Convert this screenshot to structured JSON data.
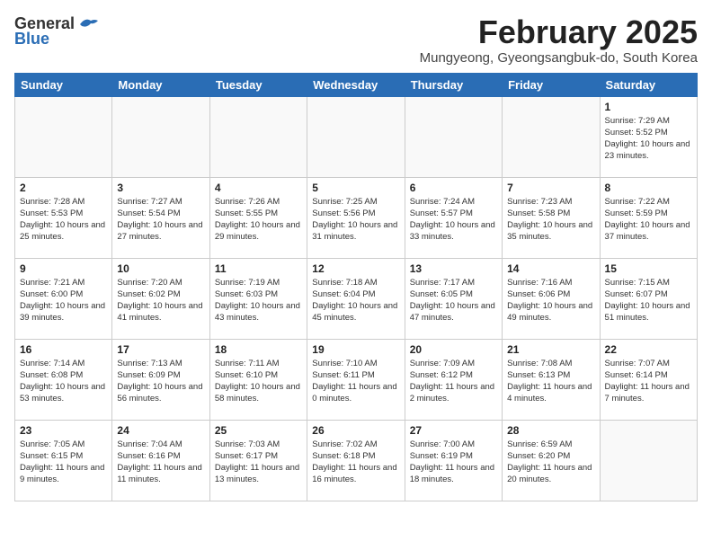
{
  "header": {
    "logo_general": "General",
    "logo_blue": "Blue",
    "month_title": "February 2025",
    "subtitle": "Mungyeong, Gyeongsangbuk-do, South Korea"
  },
  "weekdays": [
    "Sunday",
    "Monday",
    "Tuesday",
    "Wednesday",
    "Thursday",
    "Friday",
    "Saturday"
  ],
  "weeks": [
    [
      {
        "day": "",
        "info": ""
      },
      {
        "day": "",
        "info": ""
      },
      {
        "day": "",
        "info": ""
      },
      {
        "day": "",
        "info": ""
      },
      {
        "day": "",
        "info": ""
      },
      {
        "day": "",
        "info": ""
      },
      {
        "day": "1",
        "info": "Sunrise: 7:29 AM\nSunset: 5:52 PM\nDaylight: 10 hours and 23 minutes."
      }
    ],
    [
      {
        "day": "2",
        "info": "Sunrise: 7:28 AM\nSunset: 5:53 PM\nDaylight: 10 hours and 25 minutes."
      },
      {
        "day": "3",
        "info": "Sunrise: 7:27 AM\nSunset: 5:54 PM\nDaylight: 10 hours and 27 minutes."
      },
      {
        "day": "4",
        "info": "Sunrise: 7:26 AM\nSunset: 5:55 PM\nDaylight: 10 hours and 29 minutes."
      },
      {
        "day": "5",
        "info": "Sunrise: 7:25 AM\nSunset: 5:56 PM\nDaylight: 10 hours and 31 minutes."
      },
      {
        "day": "6",
        "info": "Sunrise: 7:24 AM\nSunset: 5:57 PM\nDaylight: 10 hours and 33 minutes."
      },
      {
        "day": "7",
        "info": "Sunrise: 7:23 AM\nSunset: 5:58 PM\nDaylight: 10 hours and 35 minutes."
      },
      {
        "day": "8",
        "info": "Sunrise: 7:22 AM\nSunset: 5:59 PM\nDaylight: 10 hours and 37 minutes."
      }
    ],
    [
      {
        "day": "9",
        "info": "Sunrise: 7:21 AM\nSunset: 6:00 PM\nDaylight: 10 hours and 39 minutes."
      },
      {
        "day": "10",
        "info": "Sunrise: 7:20 AM\nSunset: 6:02 PM\nDaylight: 10 hours and 41 minutes."
      },
      {
        "day": "11",
        "info": "Sunrise: 7:19 AM\nSunset: 6:03 PM\nDaylight: 10 hours and 43 minutes."
      },
      {
        "day": "12",
        "info": "Sunrise: 7:18 AM\nSunset: 6:04 PM\nDaylight: 10 hours and 45 minutes."
      },
      {
        "day": "13",
        "info": "Sunrise: 7:17 AM\nSunset: 6:05 PM\nDaylight: 10 hours and 47 minutes."
      },
      {
        "day": "14",
        "info": "Sunrise: 7:16 AM\nSunset: 6:06 PM\nDaylight: 10 hours and 49 minutes."
      },
      {
        "day": "15",
        "info": "Sunrise: 7:15 AM\nSunset: 6:07 PM\nDaylight: 10 hours and 51 minutes."
      }
    ],
    [
      {
        "day": "16",
        "info": "Sunrise: 7:14 AM\nSunset: 6:08 PM\nDaylight: 10 hours and 53 minutes."
      },
      {
        "day": "17",
        "info": "Sunrise: 7:13 AM\nSunset: 6:09 PM\nDaylight: 10 hours and 56 minutes."
      },
      {
        "day": "18",
        "info": "Sunrise: 7:11 AM\nSunset: 6:10 PM\nDaylight: 10 hours and 58 minutes."
      },
      {
        "day": "19",
        "info": "Sunrise: 7:10 AM\nSunset: 6:11 PM\nDaylight: 11 hours and 0 minutes."
      },
      {
        "day": "20",
        "info": "Sunrise: 7:09 AM\nSunset: 6:12 PM\nDaylight: 11 hours and 2 minutes."
      },
      {
        "day": "21",
        "info": "Sunrise: 7:08 AM\nSunset: 6:13 PM\nDaylight: 11 hours and 4 minutes."
      },
      {
        "day": "22",
        "info": "Sunrise: 7:07 AM\nSunset: 6:14 PM\nDaylight: 11 hours and 7 minutes."
      }
    ],
    [
      {
        "day": "23",
        "info": "Sunrise: 7:05 AM\nSunset: 6:15 PM\nDaylight: 11 hours and 9 minutes."
      },
      {
        "day": "24",
        "info": "Sunrise: 7:04 AM\nSunset: 6:16 PM\nDaylight: 11 hours and 11 minutes."
      },
      {
        "day": "25",
        "info": "Sunrise: 7:03 AM\nSunset: 6:17 PM\nDaylight: 11 hours and 13 minutes."
      },
      {
        "day": "26",
        "info": "Sunrise: 7:02 AM\nSunset: 6:18 PM\nDaylight: 11 hours and 16 minutes."
      },
      {
        "day": "27",
        "info": "Sunrise: 7:00 AM\nSunset: 6:19 PM\nDaylight: 11 hours and 18 minutes."
      },
      {
        "day": "28",
        "info": "Sunrise: 6:59 AM\nSunset: 6:20 PM\nDaylight: 11 hours and 20 minutes."
      },
      {
        "day": "",
        "info": ""
      }
    ]
  ]
}
